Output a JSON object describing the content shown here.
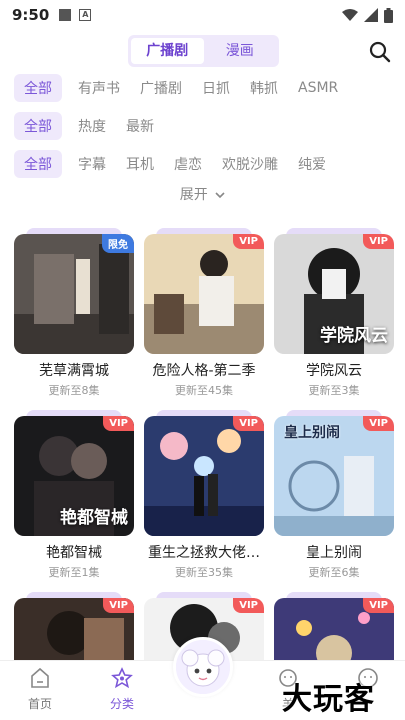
{
  "status_bar": {
    "time": "9:50"
  },
  "top_tabs": [
    {
      "label": "广播剧",
      "active": true
    },
    {
      "label": "漫画",
      "active": false
    }
  ],
  "filters": {
    "row1": [
      "全部",
      "有声书",
      "广播剧",
      "日抓",
      "韩抓",
      "ASMR"
    ],
    "row2": [
      "全部",
      "热度",
      "最新"
    ],
    "row3": [
      "全部",
      "字幕",
      "耳机",
      "虐恋",
      "欢脱沙雕",
      "纯爱"
    ],
    "expand_label": "展开"
  },
  "cards": [
    {
      "title": "芜草满霄城",
      "subtitle": "更新至8集",
      "badge": "限免",
      "badge_type": "free",
      "cover_text": ""
    },
    {
      "title": "危险人格-第二季",
      "subtitle": "更新至45集",
      "badge": "VIP",
      "badge_type": "vip",
      "cover_text": ""
    },
    {
      "title": "学院风云",
      "subtitle": "更新至3集",
      "badge": "VIP",
      "badge_type": "vip",
      "cover_text": "学院风云"
    },
    {
      "title": "艳都智械",
      "subtitle": "更新至1集",
      "badge": "VIP",
      "badge_type": "vip",
      "cover_text": "艳都智械"
    },
    {
      "title": "重生之拯救大佬…",
      "subtitle": "更新至35集",
      "badge": "VIP",
      "badge_type": "vip",
      "cover_text": ""
    },
    {
      "title": "皇上别闹",
      "subtitle": "更新至6集",
      "badge": "VIP",
      "badge_type": "vip",
      "cover_text": "皇上别闹"
    },
    {
      "title": "",
      "subtitle": "",
      "badge": "VIP",
      "badge_type": "vip",
      "cover_text": ""
    },
    {
      "title": "",
      "subtitle": "",
      "badge": "VIP",
      "badge_type": "vip",
      "cover_text": ""
    },
    {
      "title": "",
      "subtitle": "",
      "badge": "VIP",
      "badge_type": "vip",
      "cover_text": ""
    }
  ],
  "bottom_nav": [
    {
      "label": "首页",
      "icon": "home-icon",
      "active": false
    },
    {
      "label": "分类",
      "icon": "category-star-icon",
      "active": true
    },
    {
      "label": "羊",
      "icon": "sheep-icon",
      "active": false
    },
    {
      "label": "",
      "icon": "profile-icon",
      "active": false
    }
  ],
  "watermark": "大玩客",
  "colors": {
    "accent": "#7b57d8",
    "accent_bg": "#efe9fb",
    "vip": "#f25a5a",
    "free": "#3e7ae0"
  }
}
